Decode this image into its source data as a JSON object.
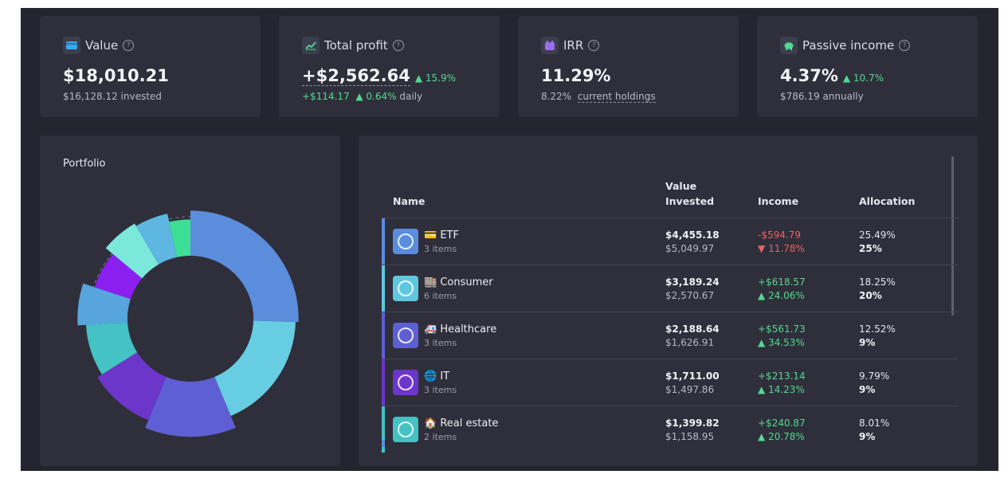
{
  "stats": {
    "value": {
      "label": "Value",
      "icon": "wallet-icon",
      "main": "$18,010.21",
      "sub": "$16,128.12 invested"
    },
    "profit": {
      "label": "Total profit",
      "icon": "chart-line-icon",
      "main": "+$2,562.64",
      "change": "15.9%",
      "sub_amount": "+$114.17",
      "sub_change": "0.64%",
      "sub_suffix": "daily"
    },
    "irr": {
      "label": "IRR",
      "icon": "calendar-icon",
      "main": "11.29%",
      "sub_value": "8.22%",
      "sub_link": "current holdings"
    },
    "passive": {
      "label": "Passive income",
      "icon": "piggy-bank-icon",
      "main": "4.37%",
      "change": "10.7%",
      "sub": "$786.19 annually"
    }
  },
  "portfolio": {
    "title": "Portfolio"
  },
  "holdings": {
    "columns": {
      "name": "Name",
      "value_line1": "Value",
      "value_line2": "Invested",
      "income": "Income",
      "allocation": "Allocation"
    },
    "rows": [
      {
        "emoji": "💳",
        "name": "ETF",
        "items": "3 items",
        "value": "$4,455.18",
        "invested": "$5,049.97",
        "income": "-$594.79",
        "income_pct": "11.78%",
        "dir": "down",
        "alloc": "25.49%",
        "target": "25%",
        "color": "#5b8ddd"
      },
      {
        "emoji": "🏬",
        "name": "Consumer",
        "items": "6 items",
        "value": "$3,189.24",
        "invested": "$2,570.67",
        "income": "+$618.57",
        "income_pct": "24.06%",
        "dir": "up",
        "alloc": "18.25%",
        "target": "20%",
        "color": "#5fc8de"
      },
      {
        "emoji": "🚑",
        "name": "Healthcare",
        "items": "3 items",
        "value": "$2,188.64",
        "invested": "$1,626.91",
        "income": "+$561.73",
        "income_pct": "34.53%",
        "dir": "up",
        "alloc": "12.52%",
        "target": "9%",
        "color": "#5d5fd2"
      },
      {
        "emoji": "🌐",
        "name": "IT",
        "items": "3 items",
        "value": "$1,711.00",
        "invested": "$1,497.86",
        "income": "+$213.14",
        "income_pct": "14.23%",
        "dir": "up",
        "alloc": "9.79%",
        "target": "9%",
        "color": "#6b36c9"
      },
      {
        "emoji": "🏠",
        "name": "Real estate",
        "items": "2 items",
        "value": "$1,399.82",
        "invested": "$1,158.95",
        "income": "+$240.87",
        "income_pct": "20.78%",
        "dir": "up",
        "alloc": "8.01%",
        "target": "9%",
        "color": "#44c2c4"
      }
    ]
  },
  "donut_segments": [
    {
      "color": "#5b8ddd",
      "value": 25.49,
      "target": 25
    },
    {
      "color": "#66cde3",
      "value": 18.25,
      "target": 20
    },
    {
      "color": "#5d5fd2",
      "value": 12.52,
      "target": 9
    },
    {
      "color": "#6b36c9",
      "value": 9.79,
      "target": 9
    },
    {
      "color": "#44c2c4",
      "value": 8.01,
      "target": 9
    },
    {
      "color": "#57a5dc",
      "value": 6.0,
      "target": 5
    },
    {
      "color": "#8b1ff0",
      "value": 6.0,
      "target": 8
    },
    {
      "color": "#7ce8dc",
      "value": 5.5,
      "target": 5
    },
    {
      "color": "#5db7e0",
      "value": 5.0,
      "target": 5
    },
    {
      "color": "#3ddf97",
      "value": 3.44,
      "target": 5
    }
  ],
  "colors": {
    "positive": "#53d98f",
    "negative": "#e86262"
  }
}
